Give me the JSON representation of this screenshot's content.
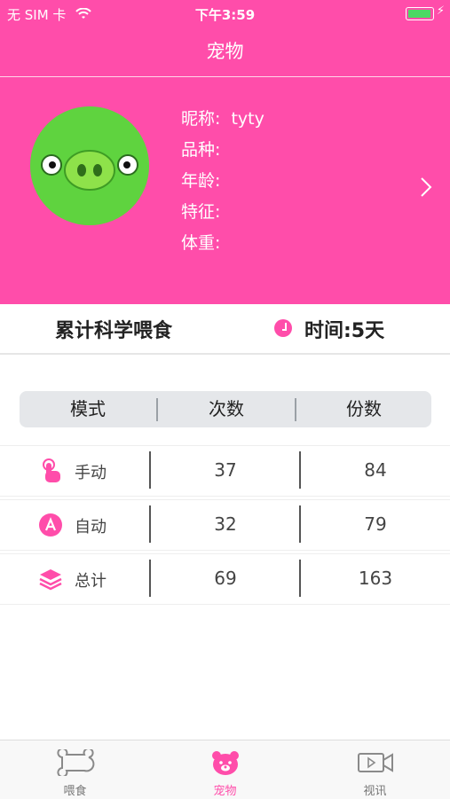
{
  "status_bar": {
    "carrier": "无 SIM 卡",
    "time": "下午3:59",
    "battery_level": 0.95
  },
  "navbar": {
    "title": "宠物"
  },
  "pet": {
    "nickname_label": "昵称:",
    "nickname_value": "tyty",
    "breed_label": "品种:",
    "age_label": "年龄:",
    "feature_label": "特征:",
    "weight_label": "体重:",
    "avatar_icon": "green-pig-avatar",
    "chevron_icon": "chevron-right-icon"
  },
  "summary": {
    "title": "累计科学喂食",
    "time_label": "时间:5天",
    "clock_icon": "clock-icon"
  },
  "table": {
    "headers": [
      "模式",
      "次数",
      "份数"
    ],
    "rows": [
      {
        "icon": "hand-tap-icon",
        "label": "手动",
        "count": "37",
        "portions": "84"
      },
      {
        "icon": "auto-a-icon",
        "label": "自动",
        "count": "32",
        "portions": "79"
      },
      {
        "icon": "layers-icon",
        "label": "总计",
        "count": "69",
        "portions": "163"
      }
    ]
  },
  "tabbar": {
    "items": [
      {
        "label": "喂食",
        "icon": "bone-icon",
        "active": false
      },
      {
        "label": "宠物",
        "icon": "bear-icon",
        "active": true
      },
      {
        "label": "视讯",
        "icon": "video-icon",
        "active": false
      }
    ]
  },
  "colors": {
    "accent": "#ff4daa",
    "active_tab": "#ff4daa",
    "header_bg": "#e5e7ea"
  }
}
